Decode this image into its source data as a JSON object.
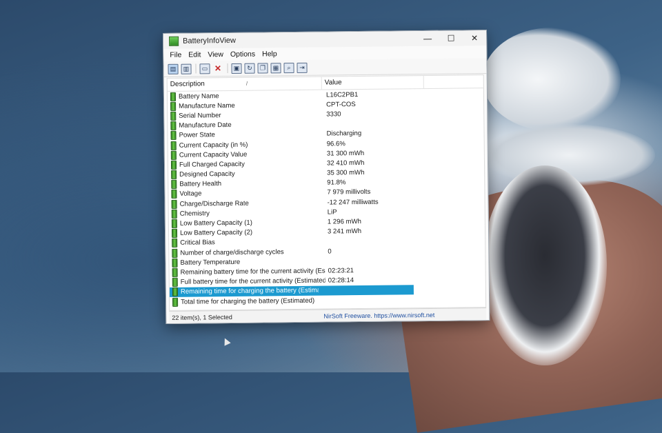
{
  "window": {
    "title": "BatteryInfoView"
  },
  "menu": [
    "File",
    "Edit",
    "View",
    "Options",
    "Help"
  ],
  "columns": {
    "description": "Description",
    "value": "Value"
  },
  "rows": [
    {
      "description": "Battery Name",
      "value": "L16C2PB1"
    },
    {
      "description": "Manufacture Name",
      "value": "CPT-COS"
    },
    {
      "description": "Serial Number",
      "value": " 3330"
    },
    {
      "description": "Manufacture Date",
      "value": ""
    },
    {
      "description": "Power State",
      "value": "Discharging"
    },
    {
      "description": "Current Capacity (in %)",
      "value": "96.6%"
    },
    {
      "description": "Current Capacity Value",
      "value": "31 300 mWh"
    },
    {
      "description": "Full Charged Capacity",
      "value": "32 410 mWh"
    },
    {
      "description": "Designed Capacity",
      "value": "35 300 mWh"
    },
    {
      "description": "Battery Health",
      "value": "91.8%"
    },
    {
      "description": "Voltage",
      "value": "7 979 millivolts"
    },
    {
      "description": "Charge/Discharge Rate",
      "value": "-12 247 milliwatts"
    },
    {
      "description": "Chemistry",
      "value": "LiP"
    },
    {
      "description": "Low Battery Capacity (1)",
      "value": "1 296 mWh"
    },
    {
      "description": "Low Battery Capacity (2)",
      "value": "3 241 mWh"
    },
    {
      "description": "Critical Bias",
      "value": ""
    },
    {
      "description": "Number of charge/discharge cycles",
      "value": "0"
    },
    {
      "description": "Battery Temperature",
      "value": ""
    },
    {
      "description": "Remaining battery time for the current activity (Est...",
      "value": "02:23:21"
    },
    {
      "description": "Full battery time for the current activity (Estimated)",
      "value": "02:28:14"
    },
    {
      "description": "Remaining time for charging the battery (Estimated)",
      "value": "",
      "selected": true
    },
    {
      "description": "Total  time for charging the battery (Estimated)",
      "value": ""
    }
  ],
  "status": {
    "count": "22 item(s), 1 Selected",
    "credit": "NirSoft Freeware. https://www.nirsoft.net"
  }
}
